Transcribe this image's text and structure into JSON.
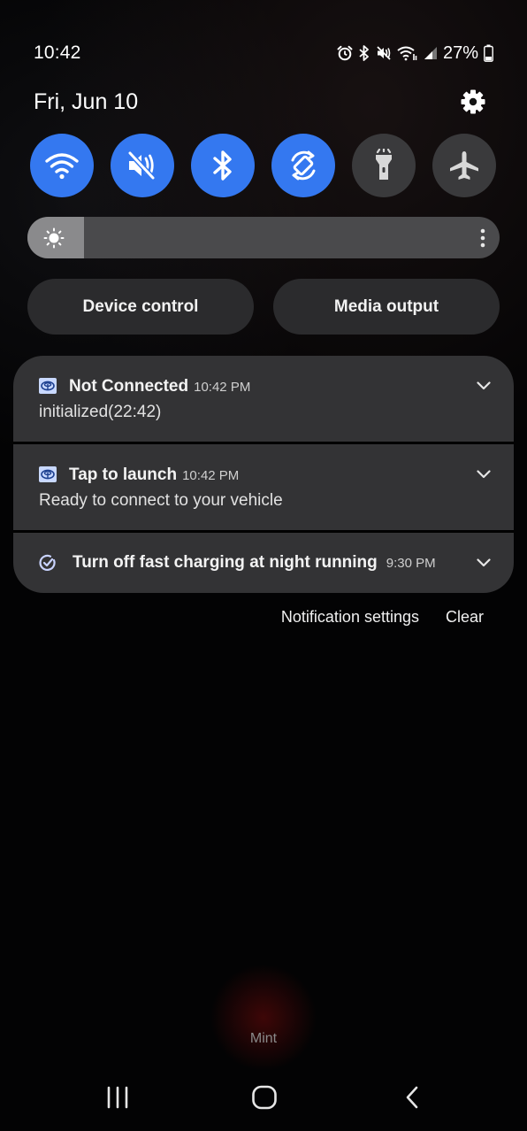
{
  "status_bar": {
    "time": "10:42",
    "battery_percent": "27%",
    "icons": [
      "alarm-icon",
      "bluetooth-icon",
      "mute-icon",
      "wifi-calling-icon",
      "signal-icon",
      "battery-icon"
    ]
  },
  "panel": {
    "date": "Fri, Jun 10",
    "settings_icon": "gear-icon"
  },
  "quick_tiles": [
    {
      "name": "wifi",
      "icon": "wifi-icon",
      "state": "on"
    },
    {
      "name": "sound",
      "icon": "mute-icon",
      "state": "on"
    },
    {
      "name": "bluetooth",
      "icon": "bluetooth-icon",
      "state": "on"
    },
    {
      "name": "auto-rotate",
      "icon": "rotate-icon",
      "state": "on"
    },
    {
      "name": "flashlight",
      "icon": "flashlight-icon",
      "state": "off"
    },
    {
      "name": "airplane-mode",
      "icon": "airplane-icon",
      "state": "off"
    }
  ],
  "brightness": {
    "level": 0.12
  },
  "buttons": {
    "device_control": "Device control",
    "media_output": "Media output"
  },
  "notifications": [
    {
      "title": "Not Connected",
      "time": "10:42 PM",
      "body": "initialized(22:42)",
      "icon": "car-app-icon"
    },
    {
      "title": "Tap to launch",
      "time": "10:42 PM",
      "body": "Ready to connect to your vehicle",
      "icon": "car-app-icon"
    },
    {
      "title": "Turn off fast charging at night running",
      "time": "9:30 PM",
      "body": "",
      "icon": "routine-check-icon"
    }
  ],
  "actions": {
    "notification_settings": "Notification settings",
    "clear": "Clear"
  },
  "carrier": "Mint",
  "colors": {
    "accent": "#3478f0",
    "tile_off": "#3a3a3c",
    "card": "#333335"
  }
}
